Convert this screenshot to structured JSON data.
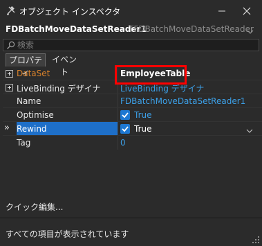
{
  "window": {
    "title": "オブジェクト インスペクタ"
  },
  "selector": {
    "name": "FDBatchMoveDataSetReader1",
    "type": "TFDBatchMoveDataSetReader"
  },
  "search": {
    "placeholder": "検索"
  },
  "tabs": [
    {
      "label": "プロパティ",
      "active": true
    },
    {
      "label": "イベント",
      "active": false
    }
  ],
  "properties": [
    {
      "name": "DataSet",
      "value": "EmployeeTable",
      "expandable": true,
      "bold_value": true,
      "name_color": "#d9822b"
    },
    {
      "name": "LiveBinding デザイナ",
      "value": "LiveBinding デザイナ",
      "expandable": true,
      "link_value": true
    },
    {
      "name": "Name",
      "value": "FDBatchMoveDataSetReader1"
    },
    {
      "name": "Optimise",
      "value": "True",
      "checked": true
    },
    {
      "name": "Rewind",
      "value": "True",
      "checked": true,
      "selected": true,
      "indicator": "»"
    },
    {
      "name": "Tag",
      "value": "0"
    }
  ],
  "quick_edit": "クイック編集...",
  "status": "すべての項目が表示されています",
  "colors": {
    "selection": "#1e6fc8",
    "link": "#3c9fe6",
    "checkbox": "#1e78d2",
    "highlight_border": "#ff0000"
  },
  "icons": [
    "app-icon",
    "minimize-icon",
    "close-icon",
    "chevron-down-icon",
    "search-icon",
    "expand-icon",
    "checkbox-icon",
    "resize-grip-icon"
  ]
}
